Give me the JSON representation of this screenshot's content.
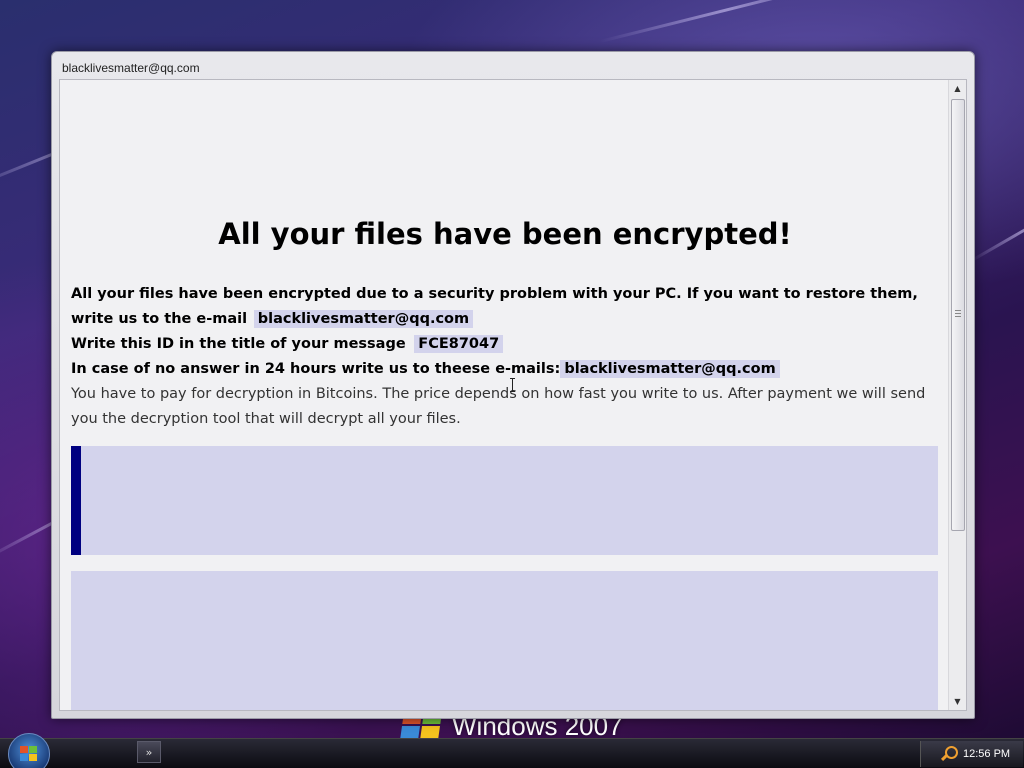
{
  "window": {
    "title": "blacklivesmatter@qq.com"
  },
  "message": {
    "heading": "All your files have been encrypted!",
    "line1_text": "All your files have been encrypted due to a security problem with your PC. If you want to restore them, write us to the e-mail",
    "line1_email": "blacklivesmatter@qq.com",
    "line2_text": "Write this ID in the title of your message",
    "line2_id": "FCE87047",
    "line3_text": "In case of no answer in 24 hours write us to theese e-mails:",
    "line3_email": "blacklivesmatter@qq.com",
    "line4_text": "You have to pay for decryption in Bitcoins. The price depends on how fast you write to us. After payment we will send you the decryption tool that will decrypt all your files."
  },
  "desktop": {
    "brand_text": "Windows 2007"
  },
  "taskbar": {
    "quicklaunch_label": "»",
    "clock": "12:56 PM"
  },
  "icons": {
    "start": "windows-logo-icon",
    "tray": "search-icon",
    "scroll_up": "arrow-up-icon",
    "scroll_down": "arrow-down-icon"
  },
  "colors": {
    "highlight": "#d3d3ec",
    "accent_bar": "#000080"
  }
}
